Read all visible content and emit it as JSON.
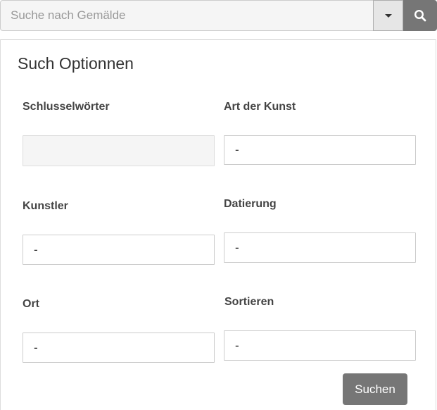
{
  "search": {
    "placeholder": "Suche nach Gemälde",
    "value": "",
    "dropdown_icon": "caret-down-icon",
    "button_icon": "search-icon"
  },
  "options": {
    "title": "Such Optionnen",
    "fields": {
      "keywords": {
        "label": "Schlusselwörter",
        "value": ""
      },
      "art_type": {
        "label": "Art der Kunst",
        "value": "-"
      },
      "artist": {
        "label": "Kunstler",
        "value": "-"
      },
      "dating": {
        "label": "Datierung",
        "value": "-"
      },
      "location": {
        "label": "Ort",
        "value": "-"
      },
      "sort": {
        "label": "Sortieren",
        "value": "-"
      }
    },
    "submit_label": "Suchen"
  },
  "colors": {
    "button_gray": "#767676",
    "border": "#cccccc",
    "disabled_bg": "#f5f5f5"
  }
}
